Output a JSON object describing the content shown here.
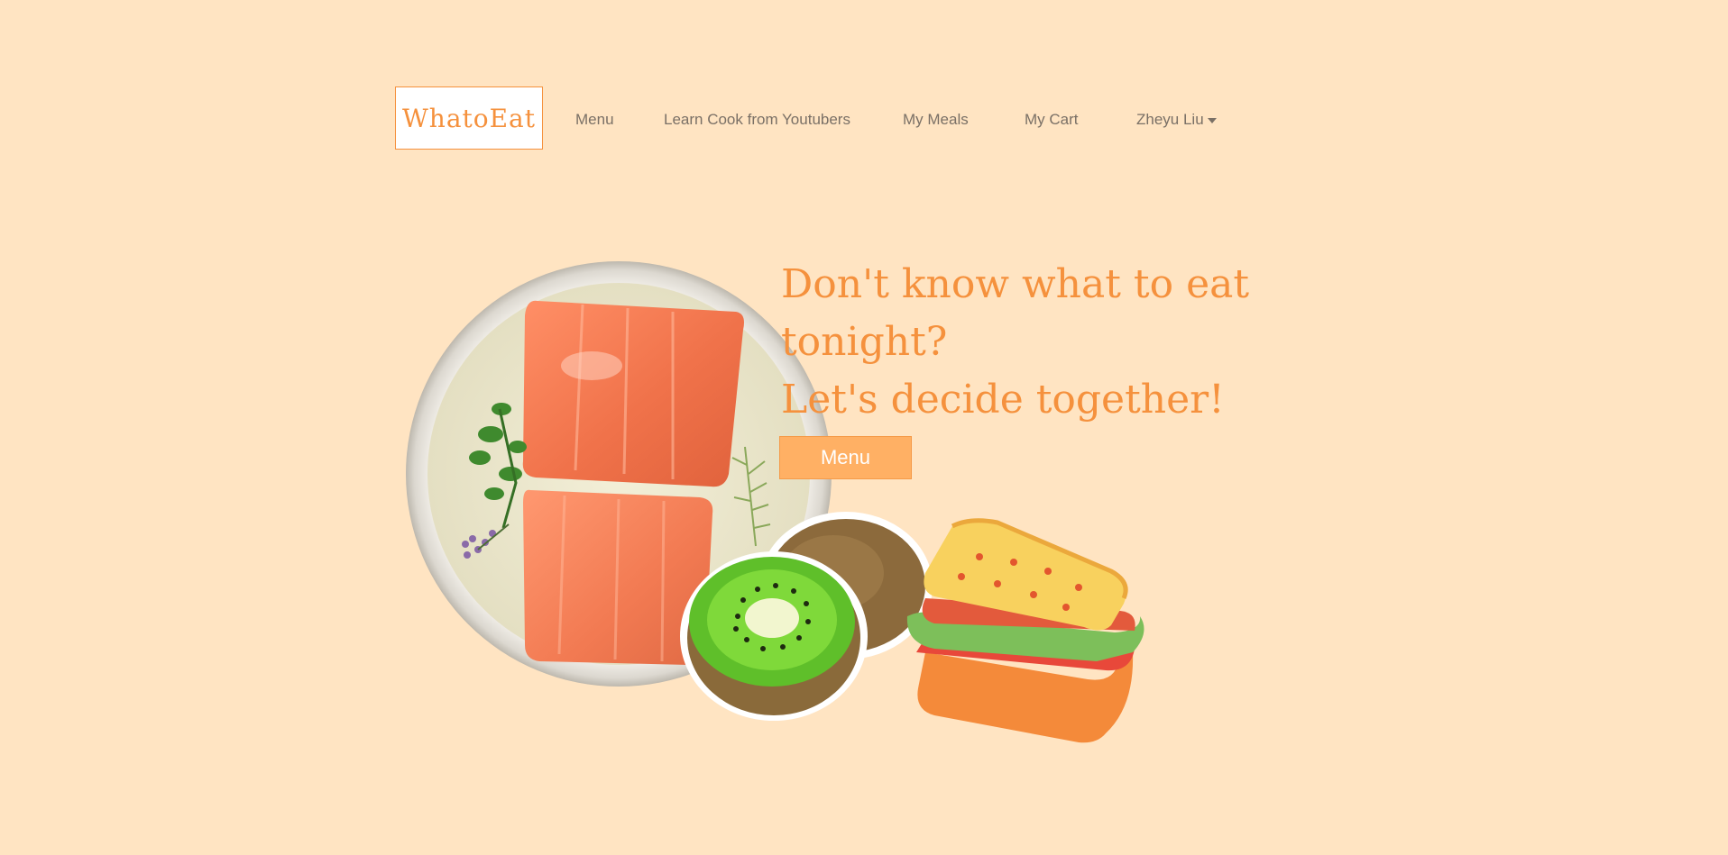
{
  "brand": {
    "logo_text": "WhatoEat"
  },
  "nav": {
    "items": [
      {
        "label": "Menu"
      },
      {
        "label": "Learn Cook from Youtubers"
      },
      {
        "label": "My Meals"
      },
      {
        "label": "My Cart"
      },
      {
        "label": "Zheyu Liu"
      }
    ]
  },
  "hero": {
    "headline_line1": "Don't know what to eat",
    "headline_line2": "tonight?",
    "headline_line3": "Let's decide together!",
    "cta_label": "Menu"
  },
  "colors": {
    "background": "#ffe4c2",
    "accent": "#f5913d",
    "button": "#ffb064",
    "nav_text": "#7a7066"
  },
  "illustrations": [
    "salmon-bowl-image",
    "kiwi-image",
    "sandwich-image"
  ]
}
